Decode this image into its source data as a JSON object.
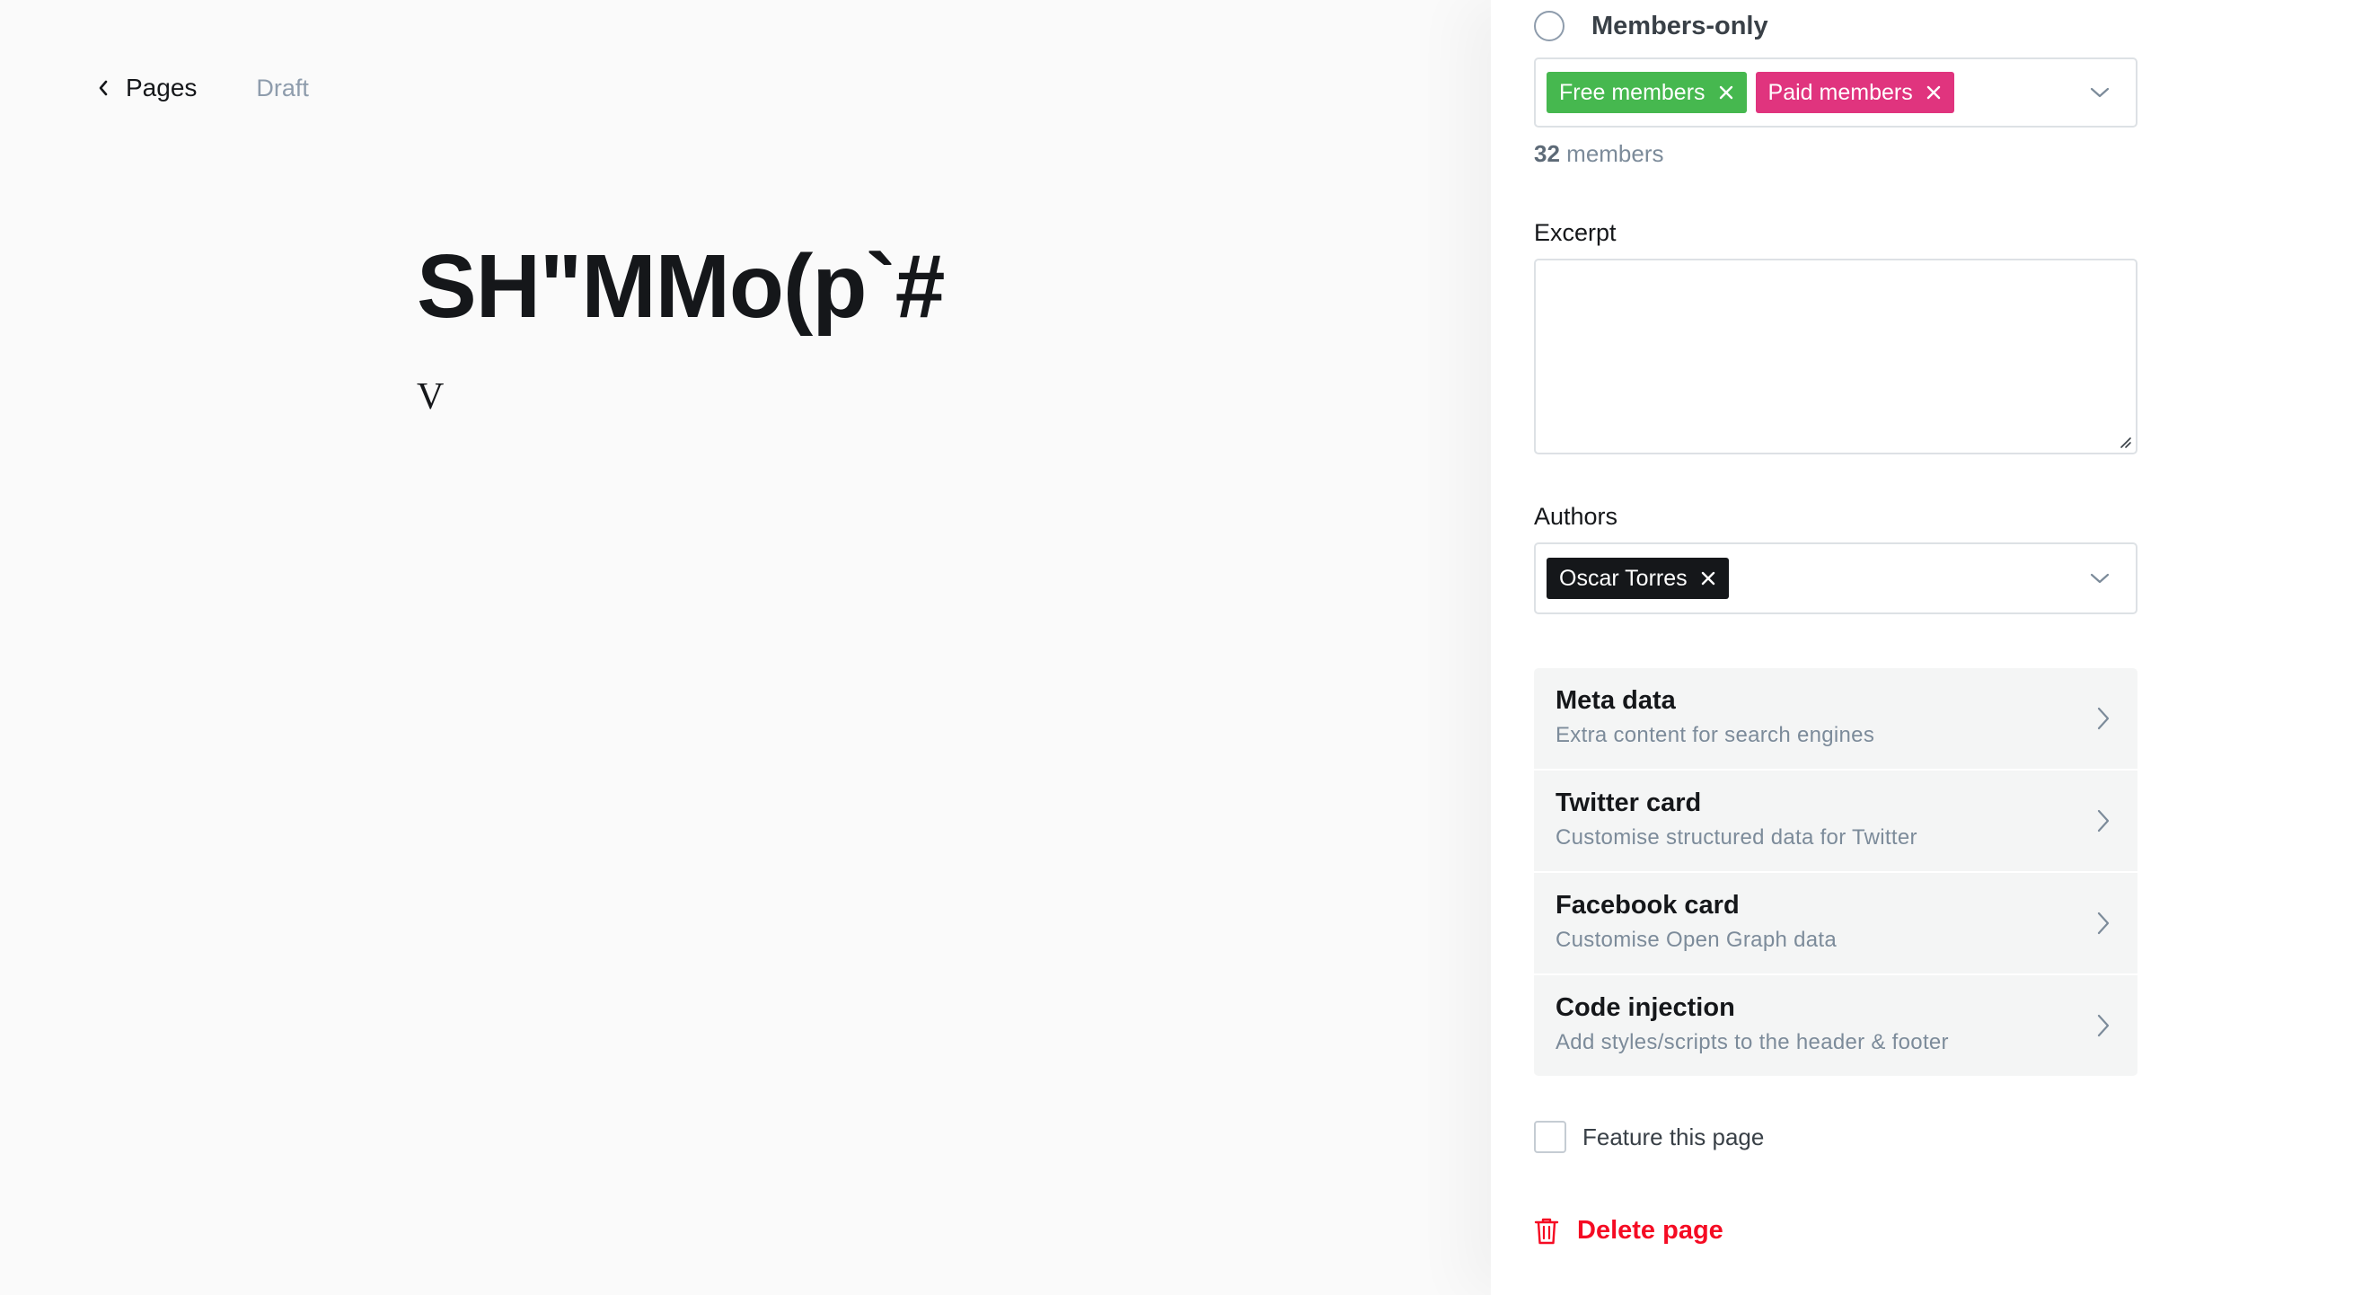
{
  "editor": {
    "back_label": "Pages",
    "status": "Draft",
    "title": "SH\"MMo(p`#",
    "body_text": "V"
  },
  "access": {
    "option_label": "Members-only",
    "tags": [
      {
        "label": "Free members",
        "color": "#46b84f"
      },
      {
        "label": "Paid members",
        "color": "#e0347e"
      }
    ],
    "count_number": "32",
    "count_suffix": "members"
  },
  "excerpt": {
    "label": "Excerpt",
    "value": ""
  },
  "authors": {
    "label": "Authors",
    "tags": [
      {
        "label": "Oscar Torres",
        "color": "#15171a"
      }
    ]
  },
  "sections": [
    {
      "title": "Meta data",
      "subtitle": "Extra content for search engines"
    },
    {
      "title": "Twitter card",
      "subtitle": "Customise structured data for Twitter"
    },
    {
      "title": "Facebook card",
      "subtitle": "Customise Open Graph data"
    },
    {
      "title": "Code injection",
      "subtitle": "Add styles/scripts to the header & footer"
    }
  ],
  "feature": {
    "label": "Feature this page",
    "checked": false
  },
  "delete": {
    "label": "Delete page",
    "color": "#f50b23"
  },
  "icons": {
    "back": "chevron-left-icon",
    "caret": "chevron-down-icon",
    "arrow": "chevron-right-icon",
    "remove": "close-icon",
    "delete": "trash-icon"
  }
}
